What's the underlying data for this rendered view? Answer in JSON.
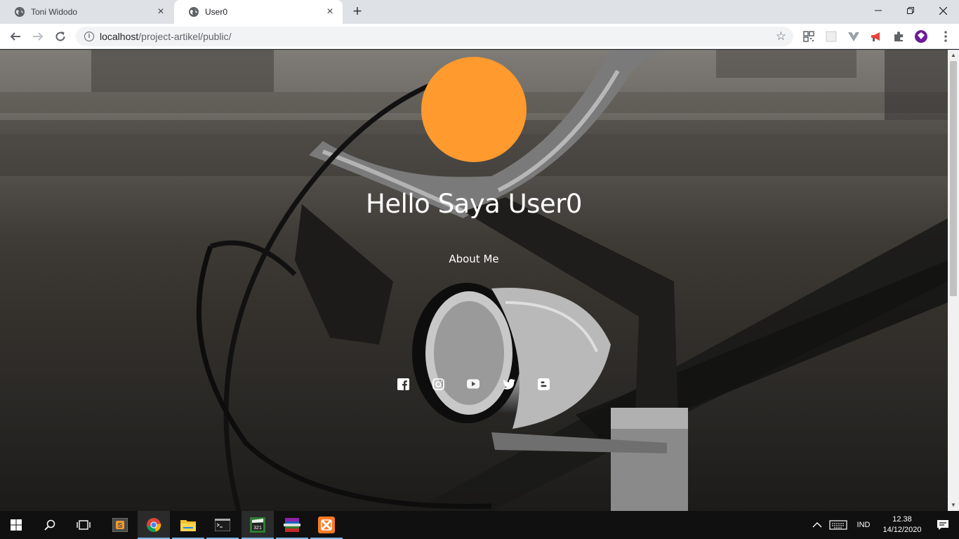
{
  "browser": {
    "tabs": [
      {
        "title": "Toni Widodo",
        "active": false
      },
      {
        "title": "User0",
        "active": true
      }
    ],
    "url": {
      "host": "localhost",
      "path": "/project-artikel/public/"
    }
  },
  "page": {
    "avatar_color": "#ff9a2e",
    "title": "Hello Saya User0",
    "about_link": "About Me",
    "social_icons": [
      "facebook-icon",
      "instagram-icon",
      "youtube-icon",
      "twitter-icon",
      "blogger-icon"
    ]
  },
  "taskbar": {
    "language": "IND",
    "time": "12.38",
    "date": "14/12/2020"
  }
}
